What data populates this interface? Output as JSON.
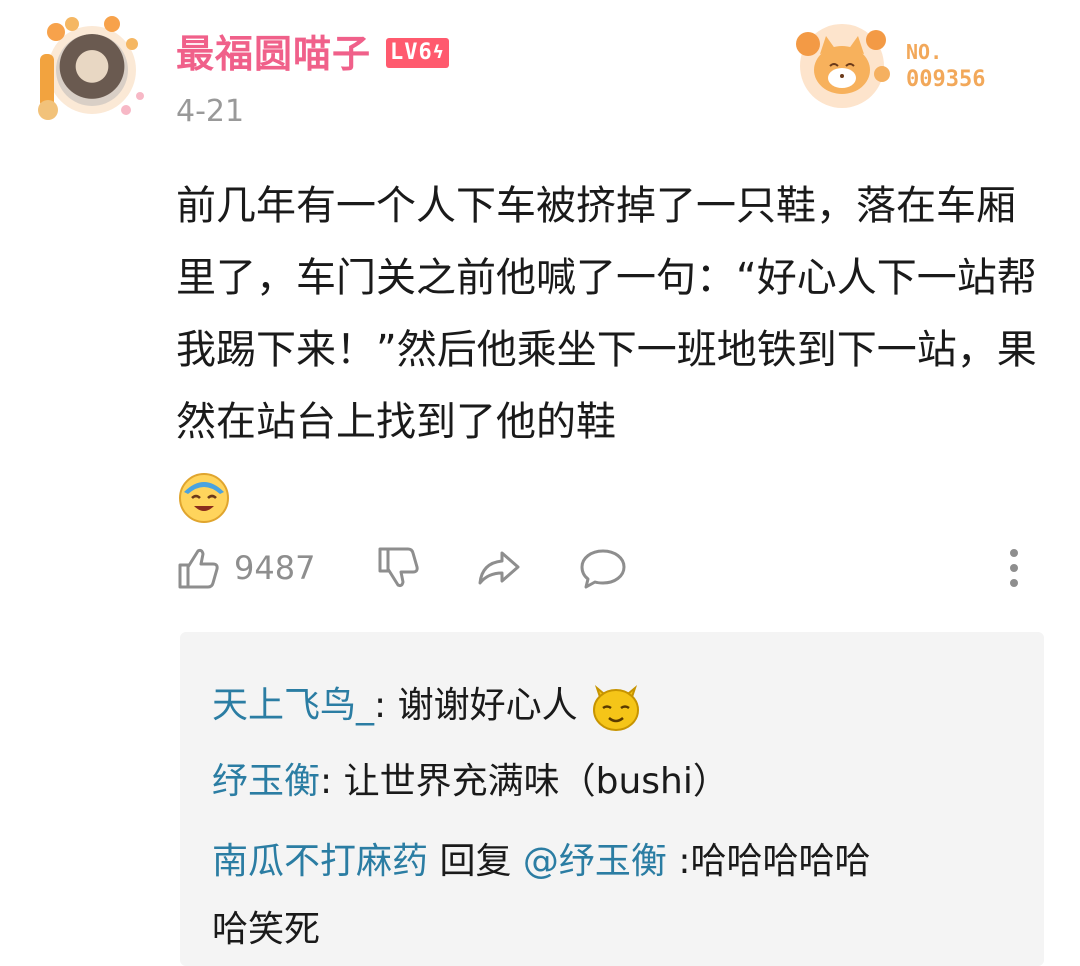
{
  "post": {
    "username": "最福圆喵子",
    "level_badge": "LV6",
    "date": "4-21",
    "fan_badge": {
      "label": "NO.",
      "number": "009356"
    },
    "body_text": "前几年有一个人下车被挤掉了一只鞋，落在车厢里了，车门关之前他喊了一句：“好心人下一站帮我踢下来！”然后他乘坐下一班地铁到下一站，果然在站台上找到了他的鞋",
    "body_emoji": "laughing-emoji",
    "like_count": "9487"
  },
  "icons": [
    "like-icon",
    "dislike-icon",
    "share-icon",
    "comment-icon",
    "more-icon",
    "bolt-icon"
  ],
  "colors": {
    "username": "#f0608a",
    "level_badge_bg": "#ff5a6e",
    "date": "#999999",
    "fan_number": "#f2a85a",
    "reply_username": "#2b7da3",
    "reply_panel_bg": "#f4f4f4",
    "action_icon": "#8e8e8e"
  },
  "replies": [
    {
      "user": "天上飞鸟_",
      "separator": ": ",
      "text": "谢谢好心人",
      "emoji": "cat-emoji"
    },
    {
      "user": "纾玉衡",
      "separator": ": ",
      "text": "让世界充满味（bushi）"
    },
    {
      "user": "南瓜不打麻药",
      "reply_word": " 回复 ",
      "mention": "@纾玉衡",
      "separator": " :",
      "text_line1": "哈哈哈哈哈",
      "text_line2": "哈笑死"
    }
  ]
}
